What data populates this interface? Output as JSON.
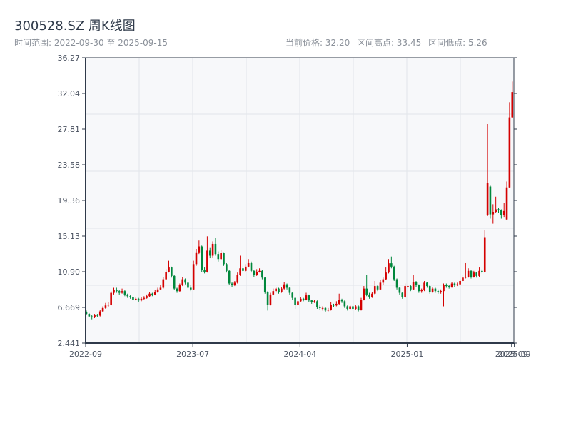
{
  "header": {
    "title": "300528.SZ 周K线图",
    "range_label": "时间范围: 2022-09-30 至 2025-09-15",
    "current_price": "当前价格: 32.20",
    "range_high": "区间高点: 33.45",
    "range_low": "区间低点: 5.26"
  },
  "colors": {
    "up": "#d40000",
    "down": "#00873c",
    "axis": "#2f3a4a",
    "grid": "#e2e5ea",
    "plot_bg": "#f7f8fa"
  },
  "chart_data": {
    "type": "candlestick",
    "title": "300528.SZ 周K线图",
    "start_date": "2022-09-30",
    "end_date": "2025-09-15",
    "ylim": [
      2.441,
      36.27
    ],
    "y_ticks": [
      "2.441",
      "6.669",
      "10.90",
      "15.13",
      "19.36",
      "23.58",
      "27.81",
      "32.04",
      "36.27"
    ],
    "x_ticks": [
      {
        "index": 0,
        "label": "2022-09"
      },
      {
        "index": 39,
        "label": "2023-07"
      },
      {
        "index": 78,
        "label": "2024-04"
      },
      {
        "index": 117,
        "label": "2025-01"
      },
      {
        "index": 155,
        "label": "2025-09"
      },
      {
        "index": 156,
        "label": "2025-09"
      }
    ],
    "grid": true,
    "candle_format": [
      "open",
      "high",
      "low",
      "close"
    ],
    "candles": [
      [
        6.1,
        6.3,
        5.8,
        5.9
      ],
      [
        5.9,
        6.0,
        5.5,
        5.6
      ],
      [
        5.6,
        5.8,
        5.26,
        5.5
      ],
      [
        5.5,
        5.9,
        5.4,
        5.8
      ],
      [
        5.8,
        5.9,
        5.5,
        5.7
      ],
      [
        5.7,
        6.4,
        5.6,
        6.2
      ],
      [
        6.2,
        6.8,
        6.1,
        6.6
      ],
      [
        6.6,
        7.2,
        6.5,
        6.9
      ],
      [
        6.9,
        7.3,
        6.7,
        7.0
      ],
      [
        7.0,
        8.6,
        6.9,
        8.4
      ],
      [
        8.4,
        9.0,
        8.2,
        8.7
      ],
      [
        8.7,
        9.0,
        8.4,
        8.6
      ],
      [
        8.6,
        8.7,
        8.2,
        8.4
      ],
      [
        8.4,
        8.9,
        8.3,
        8.6
      ],
      [
        8.6,
        8.7,
        8.0,
        8.2
      ],
      [
        8.2,
        8.3,
        7.8,
        8.0
      ],
      [
        8.0,
        8.1,
        7.7,
        7.9
      ],
      [
        7.9,
        8.0,
        7.5,
        7.6
      ],
      [
        7.6,
        7.9,
        7.5,
        7.7
      ],
      [
        7.7,
        7.8,
        7.3,
        7.5
      ],
      [
        7.5,
        7.9,
        7.4,
        7.7
      ],
      [
        7.7,
        8.0,
        7.6,
        7.8
      ],
      [
        7.8,
        8.2,
        7.7,
        8.0
      ],
      [
        8.0,
        8.5,
        7.9,
        8.3
      ],
      [
        8.3,
        8.4,
        8.0,
        8.2
      ],
      [
        8.2,
        8.7,
        8.1,
        8.5
      ],
      [
        8.5,
        9.0,
        8.4,
        8.8
      ],
      [
        8.8,
        9.3,
        8.7,
        9.0
      ],
      [
        9.0,
        10.3,
        8.9,
        10.0
      ],
      [
        10.0,
        11.2,
        9.9,
        10.9
      ],
      [
        10.9,
        12.2,
        10.8,
        11.4
      ],
      [
        11.4,
        11.5,
        10.2,
        10.4
      ],
      [
        10.4,
        10.5,
        8.7,
        8.9
      ],
      [
        8.9,
        9.0,
        8.4,
        8.6
      ],
      [
        8.6,
        9.5,
        8.5,
        9.3
      ],
      [
        9.3,
        10.3,
        9.2,
        10.0
      ],
      [
        10.0,
        10.1,
        9.4,
        9.6
      ],
      [
        9.6,
        9.7,
        8.9,
        9.0
      ],
      [
        9.0,
        9.3,
        8.6,
        8.8
      ],
      [
        8.8,
        12.2,
        8.7,
        11.8
      ],
      [
        11.8,
        13.6,
        11.6,
        13.2
      ],
      [
        13.2,
        14.6,
        13.0,
        13.9
      ],
      [
        13.9,
        14.0,
        10.9,
        11.1
      ],
      [
        11.1,
        11.4,
        10.7,
        10.9
      ],
      [
        10.9,
        15.1,
        10.8,
        13.4
      ],
      [
        13.4,
        13.8,
        12.5,
        12.8
      ],
      [
        12.8,
        14.5,
        12.6,
        14.2
      ],
      [
        14.2,
        14.9,
        12.8,
        13.0
      ],
      [
        13.0,
        13.3,
        12.1,
        12.4
      ],
      [
        12.4,
        13.5,
        12.3,
        13.1
      ],
      [
        13.1,
        13.2,
        11.6,
        11.8
      ],
      [
        11.8,
        12.0,
        10.8,
        11.0
      ],
      [
        11.0,
        11.1,
        9.3,
        9.5
      ],
      [
        9.5,
        9.7,
        9.1,
        9.3
      ],
      [
        9.3,
        9.8,
        9.2,
        9.6
      ],
      [
        9.6,
        10.8,
        9.5,
        10.5
      ],
      [
        10.5,
        12.8,
        10.4,
        11.3
      ],
      [
        11.3,
        11.6,
        10.8,
        11.0
      ],
      [
        11.0,
        11.8,
        10.9,
        11.5
      ],
      [
        11.5,
        12.4,
        11.4,
        12.0
      ],
      [
        12.0,
        12.1,
        10.8,
        11.0
      ],
      [
        11.0,
        11.1,
        10.3,
        10.5
      ],
      [
        10.5,
        11.2,
        10.4,
        10.9
      ],
      [
        10.9,
        11.3,
        10.8,
        11.0
      ],
      [
        11.0,
        11.1,
        10.0,
        10.2
      ],
      [
        10.2,
        10.3,
        8.3,
        8.5
      ],
      [
        8.5,
        8.6,
        6.3,
        7.0
      ],
      [
        7.0,
        8.4,
        6.9,
        8.2
      ],
      [
        8.2,
        8.9,
        8.1,
        8.6
      ],
      [
        8.6,
        9.1,
        8.4,
        8.9
      ],
      [
        8.9,
        9.0,
        8.3,
        8.5
      ],
      [
        8.5,
        9.1,
        8.4,
        8.9
      ],
      [
        8.9,
        9.7,
        8.8,
        9.4
      ],
      [
        9.4,
        9.5,
        8.8,
        9.0
      ],
      [
        9.0,
        9.1,
        8.2,
        8.4
      ],
      [
        8.4,
        8.5,
        7.6,
        7.8
      ],
      [
        7.8,
        7.9,
        6.5,
        7.0
      ],
      [
        7.0,
        7.6,
        6.9,
        7.4
      ],
      [
        7.4,
        7.9,
        7.3,
        7.7
      ],
      [
        7.7,
        7.8,
        7.4,
        7.6
      ],
      [
        7.6,
        8.4,
        7.5,
        8.1
      ],
      [
        8.1,
        8.2,
        7.3,
        7.5
      ],
      [
        7.5,
        7.6,
        7.1,
        7.3
      ],
      [
        7.3,
        7.6,
        7.2,
        7.4
      ],
      [
        7.4,
        7.5,
        6.5,
        6.7
      ],
      [
        6.7,
        6.9,
        6.4,
        6.6
      ],
      [
        6.6,
        6.8,
        6.3,
        6.6
      ],
      [
        6.6,
        6.7,
        6.1,
        6.3
      ],
      [
        6.3,
        6.6,
        6.2,
        6.4
      ],
      [
        6.4,
        7.3,
        6.3,
        7.0
      ],
      [
        7.0,
        7.1,
        6.7,
        6.9
      ],
      [
        6.9,
        7.4,
        6.8,
        7.1
      ],
      [
        7.1,
        8.3,
        7.0,
        7.6
      ],
      [
        7.6,
        7.7,
        7.2,
        7.4
      ],
      [
        7.4,
        7.5,
        6.6,
        6.8
      ],
      [
        6.8,
        6.9,
        6.3,
        6.5
      ],
      [
        6.5,
        7.0,
        6.4,
        6.8
      ],
      [
        6.8,
        6.9,
        6.3,
        6.5
      ],
      [
        6.5,
        7.0,
        6.4,
        6.8
      ],
      [
        6.8,
        6.9,
        6.2,
        6.4
      ],
      [
        6.4,
        7.8,
        6.3,
        7.6
      ],
      [
        7.6,
        9.2,
        7.5,
        8.9
      ],
      [
        8.9,
        10.5,
        8.0,
        8.2
      ],
      [
        8.2,
        8.4,
        7.7,
        7.9
      ],
      [
        7.9,
        8.5,
        7.8,
        8.3
      ],
      [
        8.3,
        9.8,
        8.2,
        9.2
      ],
      [
        9.2,
        9.3,
        8.6,
        8.8
      ],
      [
        8.8,
        9.9,
        8.7,
        9.6
      ],
      [
        9.6,
        10.2,
        9.3,
        10.0
      ],
      [
        10.0,
        11.4,
        9.9,
        10.8
      ],
      [
        10.8,
        12.4,
        10.7,
        11.9
      ],
      [
        11.9,
        12.7,
        11.3,
        11.5
      ],
      [
        11.5,
        11.6,
        9.8,
        10.0
      ],
      [
        10.0,
        10.1,
        8.8,
        9.0
      ],
      [
        9.0,
        9.1,
        8.2,
        8.4
      ],
      [
        8.4,
        8.5,
        7.7,
        7.9
      ],
      [
        7.9,
        9.5,
        7.8,
        9.2
      ],
      [
        9.2,
        9.4,
        8.9,
        9.2
      ],
      [
        9.2,
        9.3,
        8.6,
        8.8
      ],
      [
        8.8,
        10.5,
        8.7,
        9.7
      ],
      [
        9.7,
        9.8,
        9.1,
        9.3
      ],
      [
        9.3,
        9.4,
        8.4,
        8.6
      ],
      [
        8.6,
        8.9,
        8.4,
        8.7
      ],
      [
        8.7,
        9.8,
        8.6,
        9.6
      ],
      [
        9.6,
        9.7,
        9.0,
        9.2
      ],
      [
        9.2,
        9.3,
        8.3,
        8.5
      ],
      [
        8.5,
        9.1,
        8.4,
        8.9
      ],
      [
        8.9,
        9.0,
        8.4,
        8.6
      ],
      [
        8.6,
        8.8,
        8.3,
        8.5
      ],
      [
        8.5,
        8.8,
        8.3,
        8.6
      ],
      [
        8.6,
        9.5,
        6.8,
        9.3
      ],
      [
        9.3,
        9.5,
        9.0,
        9.2
      ],
      [
        9.2,
        9.3,
        8.9,
        9.1
      ],
      [
        9.1,
        9.7,
        9.0,
        9.5
      ],
      [
        9.5,
        9.6,
        9.1,
        9.3
      ],
      [
        9.3,
        9.6,
        9.2,
        9.4
      ],
      [
        9.4,
        10.0,
        9.3,
        9.8
      ],
      [
        9.8,
        10.5,
        9.7,
        10.2
      ],
      [
        10.2,
        12.0,
        10.1,
        10.3
      ],
      [
        10.3,
        11.3,
        10.2,
        11.0
      ],
      [
        11.0,
        11.1,
        10.1,
        10.3
      ],
      [
        10.3,
        11.0,
        10.2,
        10.8
      ],
      [
        10.8,
        10.9,
        10.2,
        10.4
      ],
      [
        10.4,
        11.4,
        10.3,
        11.0
      ],
      [
        11.0,
        11.2,
        10.7,
        10.9
      ],
      [
        10.9,
        15.8,
        10.8,
        15.0
      ],
      [
        17.6,
        28.4,
        17.5,
        21.4
      ],
      [
        21.0,
        21.1,
        17.2,
        17.7
      ],
      [
        17.7,
        18.9,
        16.6,
        18.0
      ],
      [
        18.0,
        19.8,
        17.9,
        18.3
      ],
      [
        18.3,
        18.5,
        17.9,
        18.2
      ],
      [
        18.2,
        18.3,
        17.2,
        17.6
      ],
      [
        17.6,
        19.1,
        17.4,
        18.1
      ],
      [
        17.1,
        21.6,
        17.0,
        20.9
      ],
      [
        20.9,
        31.0,
        20.8,
        29.2
      ],
      [
        29.2,
        33.45,
        29.1,
        32.2
      ]
    ]
  }
}
